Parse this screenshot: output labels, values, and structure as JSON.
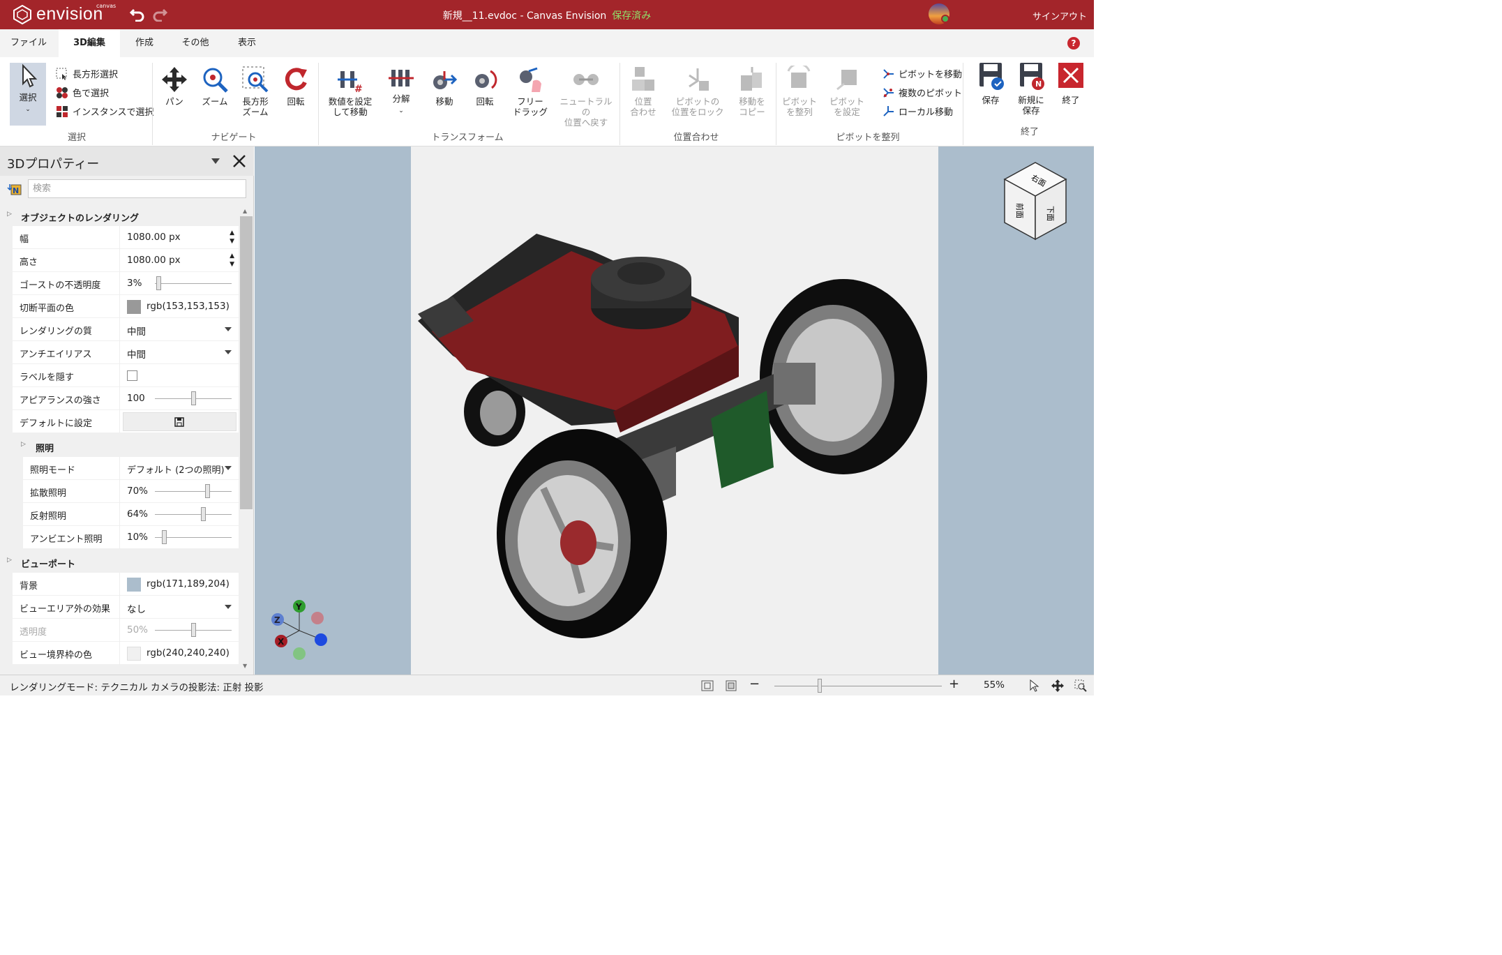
{
  "titlebar": {
    "logo_text": "envision",
    "logo_sub": "canvas",
    "document_title": "新規__11.evdoc - Canvas Envision",
    "save_status": "保存済み",
    "signout": "サインアウト"
  },
  "ribbon_tabs": [
    "ファイル",
    "3D編集",
    "作成",
    "その他",
    "表示"
  ],
  "ribbon": {
    "select_label": "選択",
    "select_rect": "長方形選択",
    "select_color": "色で選択",
    "select_instance": "インスタンスで選択",
    "group_select": "選択",
    "pan": "パン",
    "zoom": "ズーム",
    "rect_zoom_1": "長方形",
    "rect_zoom_2": "ズーム",
    "rotate": "回転",
    "group_navigate": "ナビゲート",
    "set_value_1": "数値を設定",
    "set_value_2": "して移動",
    "explode": "分解",
    "move": "移動",
    "rotate2": "回転",
    "free_drag_1": "フリー",
    "free_drag_2": "ドラッグ",
    "neutral_1": "ニュートラルの",
    "neutral_2": "位置へ戻す",
    "group_transform": "トランスフォーム",
    "align_1": "位置",
    "align_2": "合わせ",
    "pivot_lock_1": "ピボットの",
    "pivot_lock_2": "位置をロック",
    "copy_move_1": "移動を",
    "copy_move_2": "コピー",
    "group_align": "位置合わせ",
    "pivot_align_1": "ピボット",
    "pivot_align_2": "を整列",
    "pivot_set_1": "ピボット",
    "pivot_set_2": "を設定",
    "pivot_move": "ピボットを移動",
    "multi_pivot": "複数のピボット",
    "local_move": "ローカル移動",
    "group_pivot": "ピボットを整列",
    "save": "保存",
    "save_new_1": "新規に",
    "save_new_2": "保存",
    "exit": "終了",
    "group_exit": "終了"
  },
  "panel": {
    "title": "3Dプロパティー",
    "search_placeholder": "検索",
    "section_render": "オブジェクトのレンダリング",
    "width_label": "幅",
    "width_value": "1080.00 px",
    "height_label": "高さ",
    "height_value": "1080.00 px",
    "ghost_label": "ゴーストの不透明度",
    "ghost_value": "3%",
    "cut_label": "切断平面の色",
    "cut_value": "rgb(153,153,153)",
    "quality_label": "レンダリングの質",
    "quality_value": "中間",
    "aa_label": "アンチエイリアス",
    "aa_value": "中間",
    "hide_labels_label": "ラベルを隠す",
    "appearance_label": "アピアランスの強さ",
    "appearance_value": "100",
    "default_label": "デフォルトに設定",
    "section_light": "照明",
    "light_mode_label": "照明モード",
    "light_mode_value": "デフォルト (2つの照明)",
    "diffuse_label": "拡散照明",
    "diffuse_value": "70%",
    "specular_label": "反射照明",
    "specular_value": "64%",
    "ambient_label": "アンビエント照明",
    "ambient_value": "10%",
    "section_viewport": "ビューポート",
    "bg_label": "背景",
    "bg_value": "rgb(171,189,204)",
    "outside_label": "ビューエリア外の効果",
    "outside_value": "なし",
    "opacity_label": "透明度",
    "opacity_value": "50%",
    "border_label": "ビュー境界枠の色",
    "border_value": "rgb(240,240,240)"
  },
  "viewcube": {
    "right": "右面",
    "front": "前面",
    "bottom": "下面"
  },
  "axes": {
    "y": "Y",
    "z": "Z",
    "x": "X"
  },
  "status": {
    "render_mode": "レンダリングモード: テクニカル",
    "projection": "カメラの投影法: 正射 投影",
    "zoom_value": "55%"
  },
  "colors": {
    "brand": "#a3252a",
    "viewport_bg": "#abbdcc",
    "cut_plane": "#999999",
    "view_border": "#f0f0f0"
  }
}
